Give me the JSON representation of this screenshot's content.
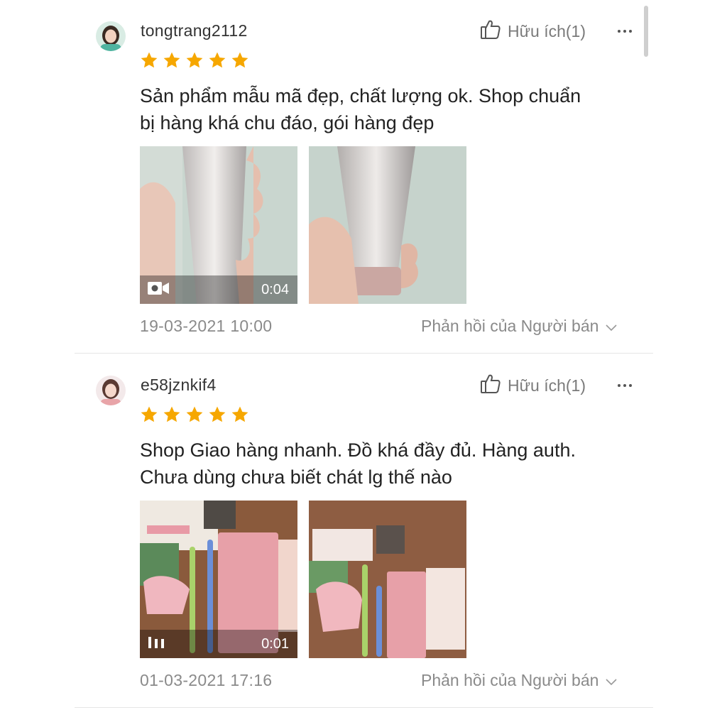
{
  "reviews": [
    {
      "username": "tongtrang2112",
      "rating": 5,
      "helpful_label": "Hữu ích(1)",
      "comment_lines": [
        "Sản phẩm mẫu mã đẹp, chất lượng ok. Shop chuẩn",
        "bị hàng khá chu đáo, gói hàng đẹp"
      ],
      "video_duration": "0:04",
      "video_icon": "video-camera-icon",
      "date": "19-03-2021 10:00",
      "reply_label": "Phản hồi của Người bán"
    },
    {
      "username": "e58jznkif4",
      "rating": 5,
      "helpful_label": "Hữu ích(1)",
      "comment_lines": [
        "Shop Giao hàng nhanh. Đồ khá đầy đủ. Hàng auth.",
        "Chưa dùng chưa biết chát lg thế nào"
      ],
      "video_duration": "0:01",
      "video_icon": "pause-icon",
      "date": "01-03-2021 17:16",
      "reply_label": "Phản hồi của Người bán"
    }
  ],
  "colors": {
    "star": "#f6a700",
    "muted_text": "#8a8a8a",
    "divider": "#e6e6e6"
  }
}
